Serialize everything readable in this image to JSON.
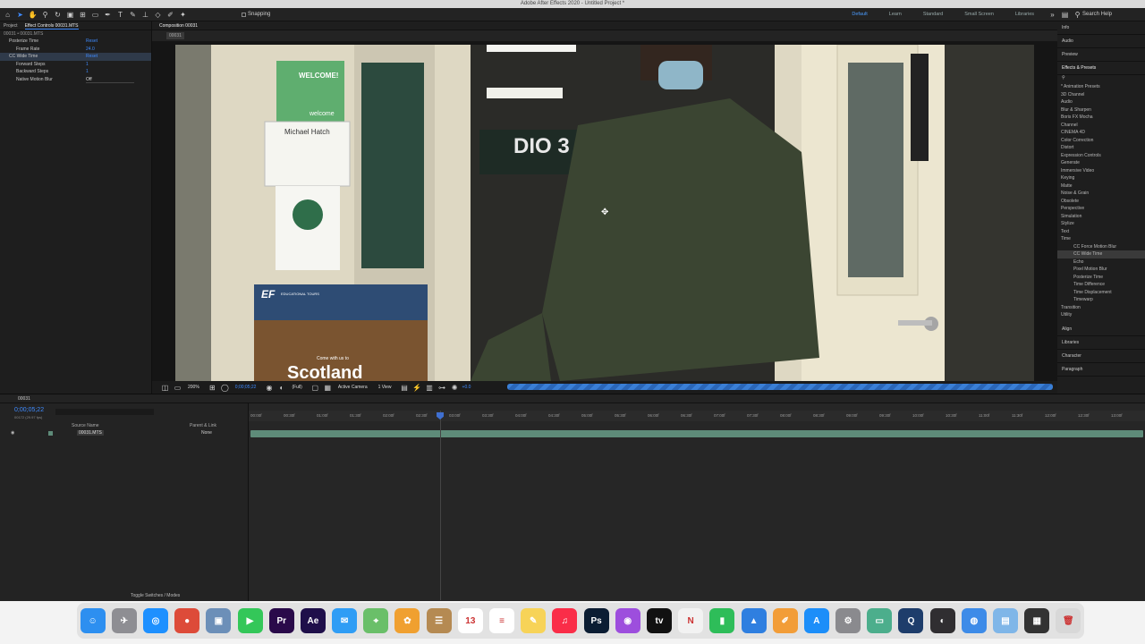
{
  "window": {
    "title": "Adobe After Effects 2020 - Untitled Project *"
  },
  "toolbar": {
    "snapping_label": "Snapping",
    "workspaces": [
      "Default",
      "Learn",
      "Standard",
      "Small Screen",
      "Libraries"
    ],
    "search_placeholder": "Search Help"
  },
  "left_panel": {
    "tabs": [
      "Project",
      "Effect Controls 00031.MTS"
    ],
    "layer_path": "00031 • 00031.MTS",
    "properties": [
      {
        "name": "Posterize Time",
        "value": "Reset"
      },
      {
        "name": "Frame Rate",
        "value": "24.0"
      },
      {
        "name": "CC Wide Time",
        "value": "Reset"
      },
      {
        "name": "Forward Steps",
        "value": "1"
      },
      {
        "name": "Backward Steps",
        "value": "1"
      },
      {
        "name": "Native Motion Blur",
        "value": "Off"
      }
    ]
  },
  "comp": {
    "tab": "Composition 00031",
    "sub_tab": "00031",
    "zoom": "200%",
    "timecode": "0;00;05;22",
    "resolution": "(Full)",
    "camera": "Active Camera",
    "views": "1 View",
    "exposure": "+0.0"
  },
  "right_panel": {
    "panels_top": [
      "Info",
      "Audio",
      "Preview"
    ],
    "effects_title": "Effects & Presets",
    "categories": [
      "* Animation Presets",
      "3D Channel",
      "Audio",
      "Blur & Sharpen",
      "Boris FX Mocha",
      "Channel",
      "CINEMA 4D",
      "Color Correction",
      "Distort",
      "Expression Controls",
      "Generate",
      "Immersive Video",
      "Keying",
      "Matte",
      "Noise & Grain",
      "Obsolete",
      "Perspective",
      "Simulation",
      "Stylize",
      "Text",
      "Time"
    ],
    "time_effects": [
      "CC Force Motion Blur",
      "CC Wide Time",
      "Echo",
      "Pixel Motion Blur",
      "Posterize Time",
      "Time Difference",
      "Time Displacement",
      "Timewarp"
    ],
    "categories_after": [
      "Transition",
      "Utility"
    ],
    "panels_bottom": [
      "Align",
      "Libraries",
      "Character",
      "Paragraph"
    ]
  },
  "timeline": {
    "tab": "00031",
    "timecode": "0;00;05;22",
    "frame_info": "00172 (29.97 fps)",
    "col_source": "Source Name",
    "col_parent": "Parent & Link",
    "layer_name": "00031.MTS",
    "parent_value": "None",
    "toggle_label": "Toggle Switches / Modes",
    "ruler": [
      "00:00f",
      "00:30f",
      "01:00f",
      "01:30f",
      "02:00f",
      "02:30f",
      "03:00f",
      "03:30f",
      "04:00f",
      "04:30f",
      "05:00f",
      "05:30f",
      "06:00f",
      "06:30f",
      "07:00f",
      "07:30f",
      "08:00f",
      "08:30f",
      "09:00f",
      "09:30f",
      "10:00f",
      "10:30f",
      "11:00f",
      "11:30f",
      "12:00f",
      "12:30f",
      "13:00f"
    ],
    "playhead_seconds": 5.73
  },
  "dock": {
    "apps": [
      {
        "icon": "finder-icon",
        "glyph": "☺",
        "color": "#2d8ff0"
      },
      {
        "icon": "launchpad-icon",
        "glyph": "✈",
        "color": "#8e8e93"
      },
      {
        "icon": "safari-icon",
        "glyph": "◎",
        "color": "#1e90ff"
      },
      {
        "icon": "chrome-icon",
        "glyph": "●",
        "color": "#dd4b39"
      },
      {
        "icon": "preview-icon",
        "glyph": "▣",
        "color": "#6c8fb8"
      },
      {
        "icon": "facetime-icon",
        "glyph": "▶",
        "color": "#34c759"
      },
      {
        "icon": "premiere-icon",
        "glyph": "Pr",
        "color": "#2a0a4a"
      },
      {
        "icon": "after-effects-icon",
        "glyph": "Ae",
        "color": "#1f0f4a"
      },
      {
        "icon": "messages-icon",
        "glyph": "✉",
        "color": "#2f9df5"
      },
      {
        "icon": "maps-icon",
        "glyph": "⌖",
        "color": "#6abf69"
      },
      {
        "icon": "photos-icon",
        "glyph": "✿",
        "color": "#f0a030"
      },
      {
        "icon": "contacts-icon",
        "glyph": "☰",
        "color": "#b58a52"
      },
      {
        "icon": "calendar-icon",
        "glyph": "13",
        "color": "#ffffff"
      },
      {
        "icon": "reminders-icon",
        "glyph": "≡",
        "color": "#ffffff"
      },
      {
        "icon": "notes-icon",
        "glyph": "✎",
        "color": "#f7d358"
      },
      {
        "icon": "music-icon",
        "glyph": "♫",
        "color": "#fa2d48"
      },
      {
        "icon": "photoshop-icon",
        "glyph": "Ps",
        "color": "#0b1d33"
      },
      {
        "icon": "podcasts-icon",
        "glyph": "◉",
        "color": "#9d4edd"
      },
      {
        "icon": "tv-icon",
        "glyph": "tv",
        "color": "#111111"
      },
      {
        "icon": "news-icon",
        "glyph": "N",
        "color": "#f2f2f2"
      },
      {
        "icon": "numbers-icon",
        "glyph": "▮",
        "color": "#2ebd59"
      },
      {
        "icon": "keynote-icon",
        "glyph": "▲",
        "color": "#2f7fe0"
      },
      {
        "icon": "pages-icon",
        "glyph": "✐",
        "color": "#f29d38"
      },
      {
        "icon": "app-store-icon",
        "glyph": "A",
        "color": "#1c8ef9"
      },
      {
        "icon": "system-preferences-icon",
        "glyph": "⚙",
        "color": "#8a8a8e"
      },
      {
        "icon": "screenshot-icon",
        "glyph": "▭",
        "color": "#4cae8c"
      },
      {
        "icon": "quicktime-icon",
        "glyph": "Q",
        "color": "#1e3d6b"
      },
      {
        "icon": "obs-icon",
        "glyph": "◐",
        "color": "#302e31"
      },
      {
        "icon": "network-icon",
        "glyph": "◍",
        "color": "#3d8be8"
      },
      {
        "icon": "downloads-folder-icon",
        "glyph": "▤",
        "color": "#7fb6e8"
      },
      {
        "icon": "screen-recording-icon",
        "glyph": "▦",
        "color": "#333333"
      },
      {
        "icon": "trash-icon",
        "glyph": "🗑",
        "color": "#d8d8d8"
      }
    ]
  },
  "scene": {
    "poster1_title": "WELCOME!",
    "poster1_bottom": "welcome",
    "poster2_name": "Michael Hatch",
    "studio_sign": "DIO 3",
    "poster3_brand": "EF",
    "poster3_sub": "EDUCATIONAL TOURS",
    "poster3_tag": "Come with us to",
    "poster3_title": "Scotland"
  }
}
